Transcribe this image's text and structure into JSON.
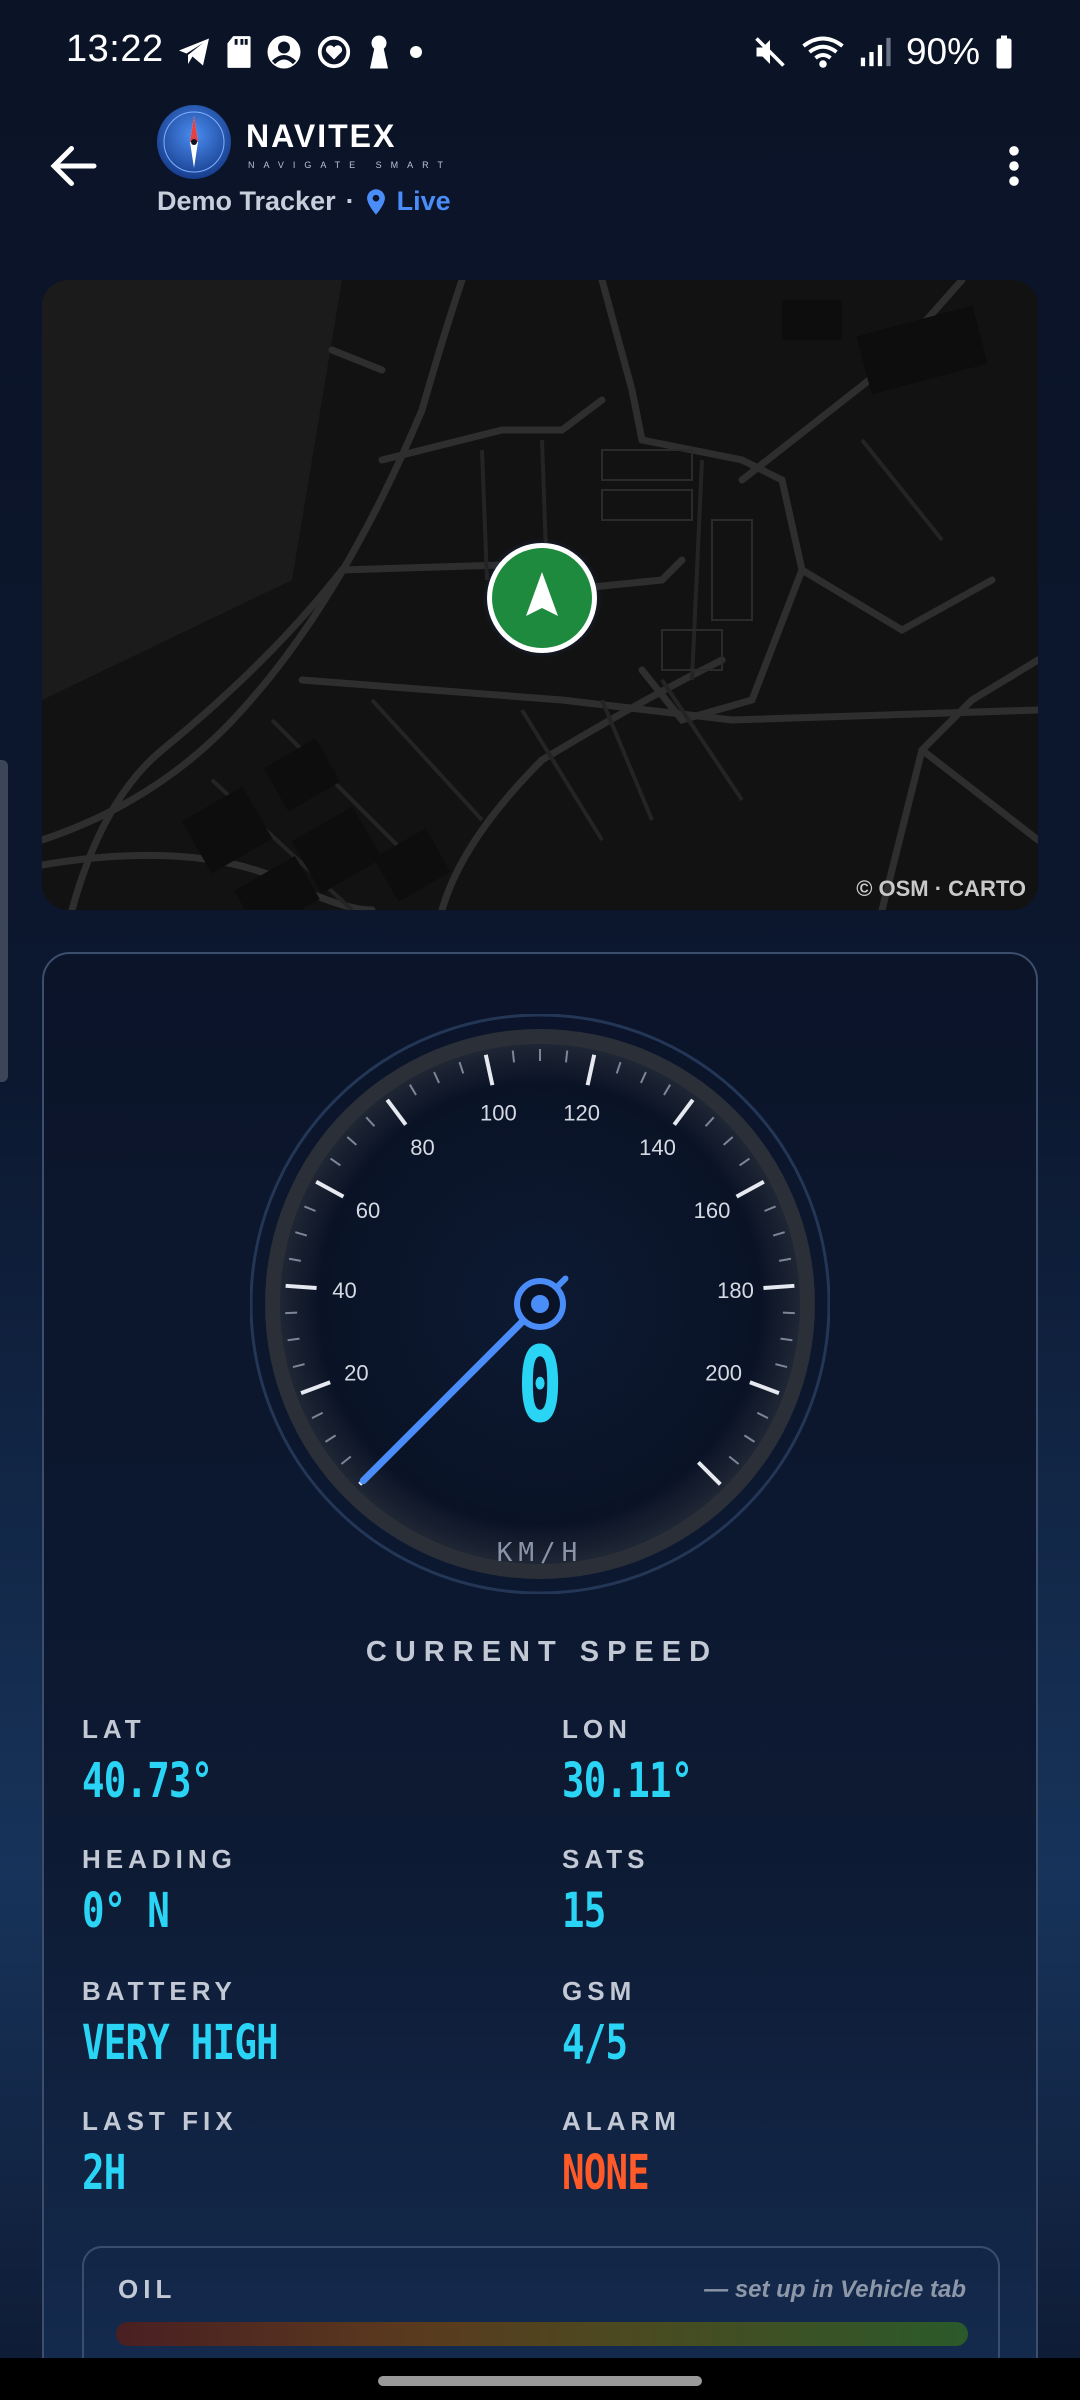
{
  "status_bar": {
    "time": "13:22",
    "left_icons": [
      "telegram-icon",
      "sd-card-icon",
      "account-circle-icon",
      "heart-sync-icon",
      "keyhole-icon",
      "dot-icon"
    ],
    "right_icons": [
      "mute-icon",
      "wifi-icon",
      "signal-icon",
      "battery-icon"
    ],
    "battery_percent": "90%"
  },
  "header": {
    "back_icon": "arrow-left-icon",
    "logo_icon": "compass-icon",
    "brand_name": "NAVITEX",
    "brand_tagline": "NAVIGATE SMART",
    "tracker_name": "Demo Tracker",
    "separator": "·",
    "live_icon": "location-pin-icon",
    "live_label": "Live",
    "more_icon": "more-vertical-icon"
  },
  "map": {
    "attribution": "© OSM · CARTO",
    "marker_icon": "navigation-arrow-icon",
    "marker_color": "#1e8a3e"
  },
  "gauge": {
    "speed_value": "0",
    "unit": "KM/H",
    "caption": "CURRENT SPEED",
    "tick_labels": [
      "20",
      "40",
      "60",
      "80",
      "100",
      "120",
      "140",
      "160",
      "180",
      "200"
    ],
    "needle_speed": 0,
    "accent_color": "#2ad4f5"
  },
  "stats": {
    "lat": {
      "label": "LAT",
      "value": "40.73°"
    },
    "lon": {
      "label": "LON",
      "value": "30.11°"
    },
    "heading": {
      "label": "HEADING",
      "value": "0° N"
    },
    "sats": {
      "label": "SATS",
      "value": "15"
    },
    "battery": {
      "label": "BATTERY",
      "value": "VERY HIGH"
    },
    "gsm": {
      "label": "GSM",
      "value": "4/5"
    },
    "last_fix": {
      "label": "LAST FIX",
      "value": "2H"
    },
    "alarm": {
      "label": "ALARM",
      "value": "NONE"
    }
  },
  "oil": {
    "label": "OIL",
    "note": "— set up in Vehicle tab"
  },
  "colors": {
    "background": "#0b1326",
    "live": "#4b8df8",
    "alarm": "#ff5a28"
  }
}
